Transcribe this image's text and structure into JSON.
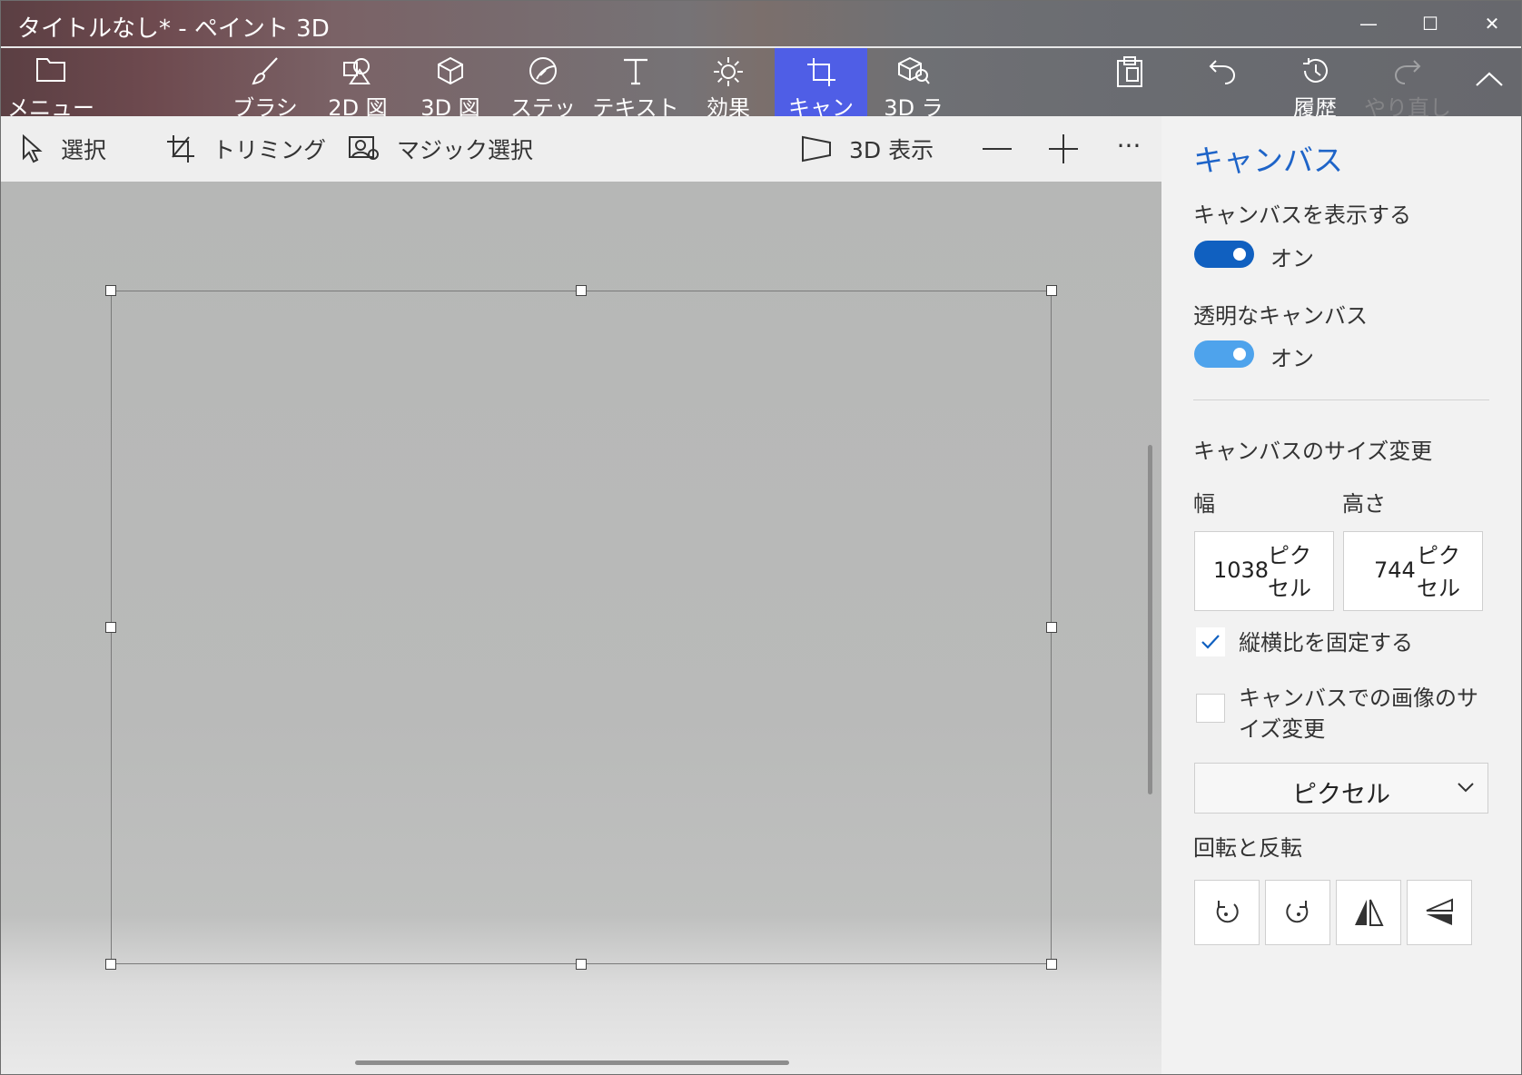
{
  "window": {
    "title": "タイトルなし* - ペイント 3D",
    "min_glyph": "—",
    "max_glyph": "☐",
    "close_glyph": "✕"
  },
  "ribbon": {
    "menu": "メニュー",
    "brushes": "ブラシ",
    "shapes2d": "2D 図",
    "shapes3d": "3D 図",
    "stickers": "ステッ",
    "text": "テキスト",
    "effects": "効果",
    "canvas": "キャン",
    "library3d": "3D ラ",
    "history": "履歴",
    "redo": "やり直し"
  },
  "toolbar": {
    "select": "選択",
    "crop": "トリミング",
    "magic_select": "マジック選択",
    "view3d": "3D 表示",
    "more": "···"
  },
  "panel": {
    "title": "キャンバス",
    "show_canvas_label": "キャンバスを表示する",
    "show_canvas_state": "オン",
    "transparent_label": "透明なキャンバス",
    "transparent_state": "オン",
    "resize_label": "キャンバスのサイズ変更",
    "width_label": "幅",
    "height_label": "高さ",
    "width_value": "1038",
    "height_value": "744",
    "unit_short": "ピクセル",
    "lock_aspect_label": "縦横比を固定する",
    "lock_aspect_checked": true,
    "resize_image_label": "キャンバスでの画像のサイズ変更",
    "resize_image_checked": false,
    "units_selected": "ピクセル",
    "rotate_label": "回転と反転"
  },
  "colors": {
    "accent": "#1e64c8",
    "toggle_on": "#1060c0",
    "toggle_on_light": "#4ea3ec",
    "active_tab": "#4f5ee6"
  }
}
